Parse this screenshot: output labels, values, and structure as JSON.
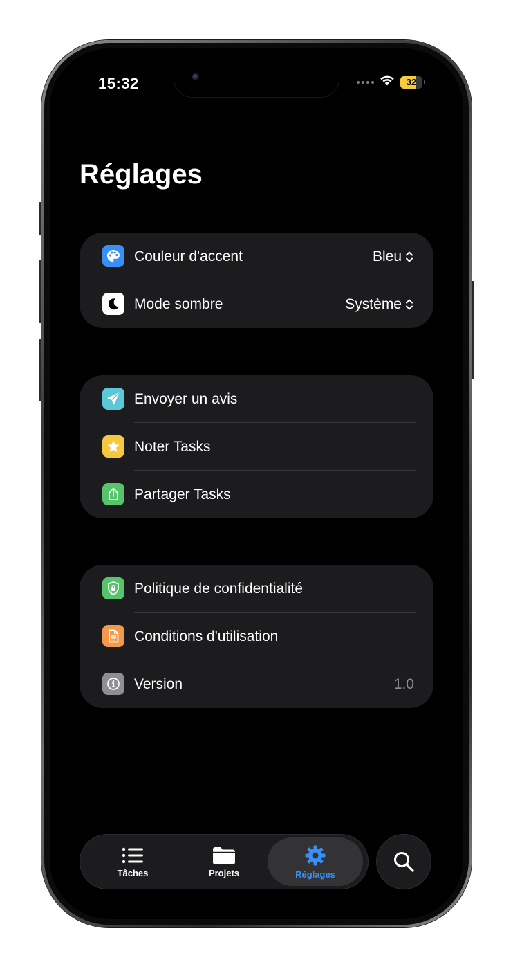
{
  "status_bar": {
    "time": "15:32",
    "battery": "32",
    "battery_level_percent": 32
  },
  "page": {
    "title": "Réglages"
  },
  "groups": [
    {
      "rows": [
        {
          "label": "Couleur d'accent",
          "value": "Bleu",
          "icon": "palette-icon",
          "icon_color": "#3a8ff5"
        },
        {
          "label": "Mode sombre",
          "value": "Système",
          "icon": "moon-icon",
          "icon_color": "#ffffff"
        }
      ]
    },
    {
      "rows": [
        {
          "label": "Envoyer un avis",
          "icon": "paperplane-icon",
          "icon_color": "#5ac8d8"
        },
        {
          "label": "Noter Tasks",
          "icon": "star-icon",
          "icon_color": "#f6c83f"
        },
        {
          "label": "Partager Tasks",
          "icon": "share-icon",
          "icon_color": "#55c46a"
        }
      ]
    },
    {
      "rows": [
        {
          "label": "Politique de confidentialité",
          "icon": "lock-shield-icon",
          "icon_color": "#55c46a"
        },
        {
          "label": "Conditions d'utilisation",
          "icon": "document-icon",
          "icon_color": "#f2994a"
        },
        {
          "label": "Version",
          "value": "1.0",
          "icon": "info-icon",
          "icon_color": "#8e8e93"
        }
      ]
    }
  ],
  "tabbar": {
    "tabs": [
      {
        "label": "Tâches",
        "icon": "list-icon"
      },
      {
        "label": "Projets",
        "icon": "folder-icon"
      },
      {
        "label": "Réglages",
        "icon": "gear-icon",
        "active": true
      }
    ],
    "search_icon": "search-icon"
  },
  "colors": {
    "background": "#000000",
    "card": "#1c1c1e",
    "accent": "#3a8ff5",
    "battery": "#f4cc3e"
  }
}
